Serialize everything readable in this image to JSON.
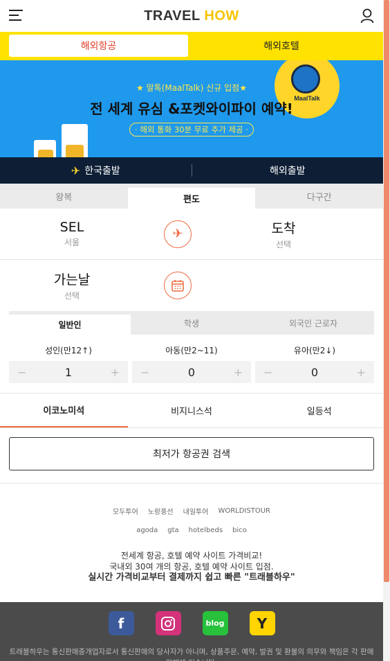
{
  "header": {
    "logo_part1": "TRAVEL",
    "logo_part2": "HOW"
  },
  "main_tabs": [
    "해외항공",
    "해외호텔"
  ],
  "banner": {
    "sub": "★ 말톡(MaalTalk) 신규 입점★",
    "title": "전 세계 유심 &포켓와이파이 예약!",
    "pill": "· 해외 통화 30분 무료 추가 제공 ·",
    "badge": "MaalTalk"
  },
  "departure": {
    "korea": "한국출발",
    "overseas": "해외출발"
  },
  "trip_tabs": [
    "왕복",
    "편도",
    "다구간"
  ],
  "route": {
    "origin_code": "SEL",
    "origin_name": "서울",
    "dest_code": "도착",
    "dest_sub": "선택"
  },
  "date": {
    "label": "가는날",
    "sub": "선택"
  },
  "pax_tabs": [
    "일반인",
    "학생",
    "외국인 근로자"
  ],
  "counters": [
    {
      "label": "성인(만12↑)",
      "value": "1"
    },
    {
      "label": "아동(만2~11)",
      "value": "0"
    },
    {
      "label": "유아(만2↓)",
      "value": "0"
    }
  ],
  "cabin": [
    "이코노미석",
    "비지니스석",
    "일등석"
  ],
  "search_label": "최저가 항공권 검색",
  "partners": [
    "모두투어",
    "노랑풍선",
    "내일투어",
    "WORLDISTOUR",
    "agoda",
    "gta",
    "hotelbeds",
    "bico"
  ],
  "tagline": {
    "line1": "전세계 항공, 호텔 예약 사이트 가격비교!",
    "line2": "국내외 30여 개의 항공, 호텔 예약 사이트 입점.",
    "line3": "실시간 가격비교부터 결제까지 쉽고 빠른 \"트래블하우\""
  },
  "social": {
    "facebook": "f",
    "blog": "blog",
    "yellow": "Y"
  },
  "legal": "트래블하우는 통신판매중개업자로서 통신판매의 당사자가 아니며, 상품주문, 예약, 발권 및 환불의 의무와 책임은 각 판매업체에 있습니다.",
  "colors": {
    "accent": "#ef6a3f",
    "brand_yellow": "#ffe200",
    "banner_blue": "#1f99ec",
    "navy": "#0d1e35"
  }
}
